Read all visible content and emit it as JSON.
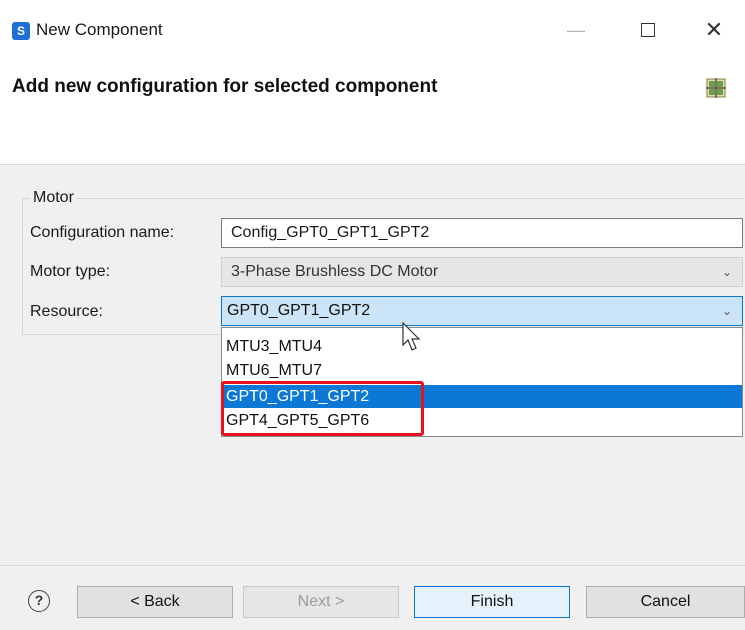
{
  "window": {
    "title": "New Component",
    "app_icon_letter": "S",
    "minimize_glyph": "—",
    "close_glyph": "✕"
  },
  "header": {
    "title": "Add new configuration for selected component",
    "icon": "wizard-banner-icon"
  },
  "group": {
    "legend": "Motor",
    "fields": {
      "name_label": "Configuration name:",
      "name_value": "Config_GPT0_GPT1_GPT2",
      "type_label": "Motor type:",
      "type_value": "3-Phase Brushless DC Motor",
      "resource_label": "Resource:",
      "resource_value": "GPT0_GPT1_GPT2"
    }
  },
  "dropdown": {
    "options": [
      "MTU3_MTU4",
      "MTU6_MTU7",
      "GPT0_GPT1_GPT2",
      "GPT4_GPT5_GPT6"
    ],
    "selected_index": 2
  },
  "footer": {
    "help_glyph": "?",
    "back_label": "< Back",
    "next_label": "Next >",
    "finish_label": "Finish",
    "cancel_label": "Cancel"
  },
  "colors": {
    "selection": "#0a78d4",
    "highlight_box": "#e5131c",
    "dialog_bg": "#f0f0f0"
  }
}
